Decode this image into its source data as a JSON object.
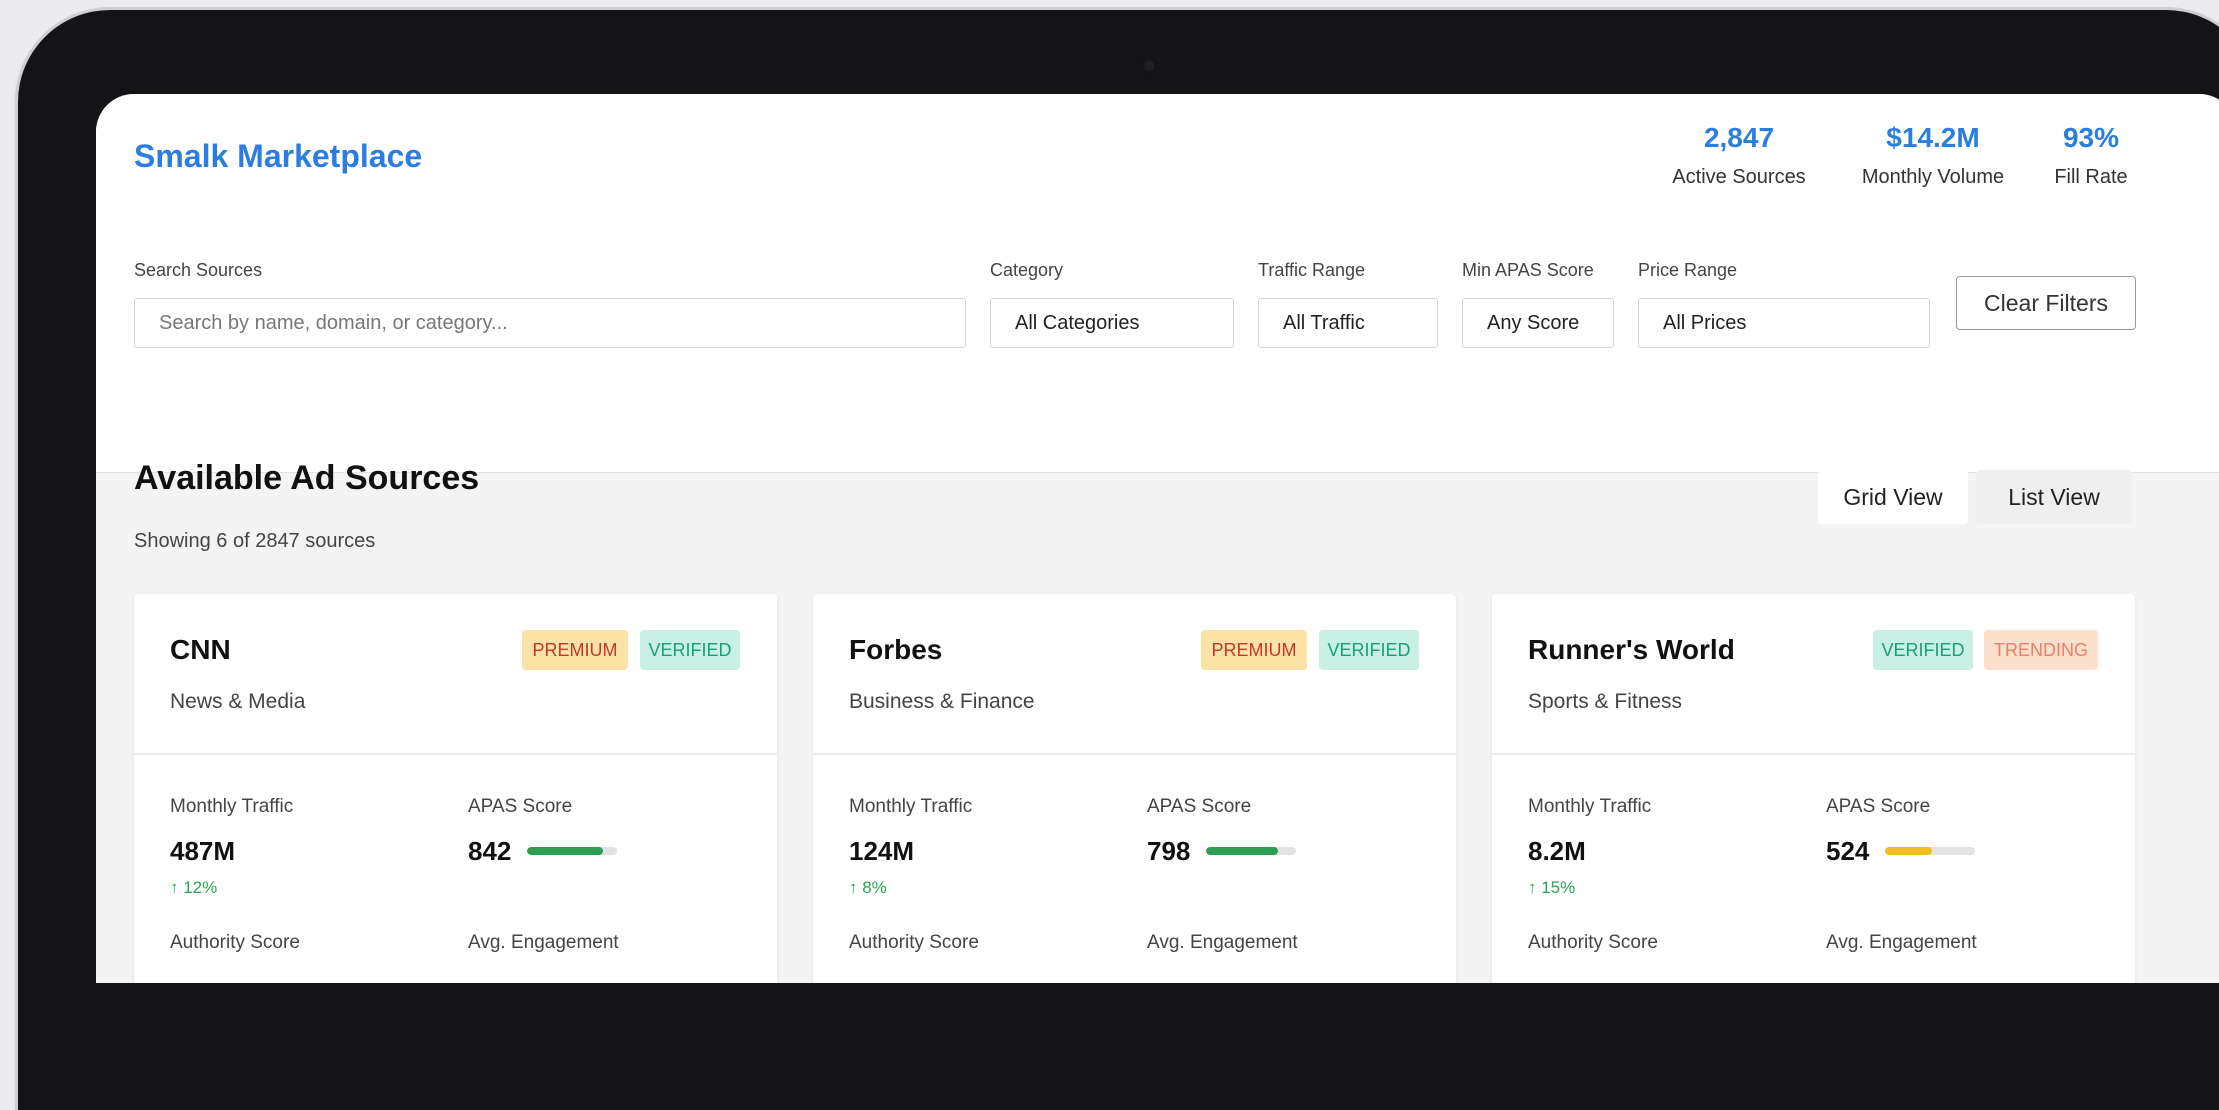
{
  "header": {
    "brand": "Smalk Marketplace",
    "stats": [
      {
        "value": "2,847",
        "label": "Active Sources"
      },
      {
        "value": "$14.2M",
        "label": "Monthly Volume"
      },
      {
        "value": "93%",
        "label": "Fill Rate"
      }
    ]
  },
  "filters": {
    "search_label": "Search Sources",
    "search_placeholder": "Search by name, domain, or category...",
    "category_label": "Category",
    "category_value": "All Categories",
    "traffic_label": "Traffic Range",
    "traffic_value": "All Traffic",
    "apas_label": "Min APAS Score",
    "apas_value": "Any Score",
    "price_label": "Price Range",
    "price_value": "All Prices",
    "clear_label": "Clear Filters"
  },
  "main": {
    "title": "Available Ad Sources",
    "showing": "Showing 6 of 2847 sources",
    "grid_view": "Grid View",
    "list_view": "List View"
  },
  "colors": {
    "accent": "#2b7de0",
    "green_bar": "#2e9e55",
    "yellow_bar": "#f0c020",
    "trend_green": "#27a555"
  },
  "cards": [
    {
      "name": "CNN",
      "category": "News & Media",
      "badges": [
        "PREMIUM",
        "VERIFIED"
      ],
      "traffic_label": "Monthly Traffic",
      "traffic": "487M",
      "trend": "↑ 12%",
      "apas_label": "APAS Score",
      "apas": "842",
      "apas_fraction": 0.842,
      "authority_label": "Authority Score",
      "engagement_label": "Avg. Engagement"
    },
    {
      "name": "Forbes",
      "category": "Business & Finance",
      "badges": [
        "PREMIUM",
        "VERIFIED"
      ],
      "traffic_label": "Monthly Traffic",
      "traffic": "124M",
      "trend": "↑ 8%",
      "apas_label": "APAS Score",
      "apas": "798",
      "apas_fraction": 0.798,
      "authority_label": "Authority Score",
      "engagement_label": "Avg. Engagement"
    },
    {
      "name": "Runner's World",
      "category": "Sports & Fitness",
      "badges": [
        "VERIFIED",
        "TRENDING"
      ],
      "traffic_label": "Monthly Traffic",
      "traffic": "8.2M",
      "trend": "↑ 15%",
      "apas_label": "APAS Score",
      "apas": "524",
      "apas_fraction": 0.524,
      "authority_label": "Authority Score",
      "engagement_label": "Avg. Engagement"
    }
  ]
}
